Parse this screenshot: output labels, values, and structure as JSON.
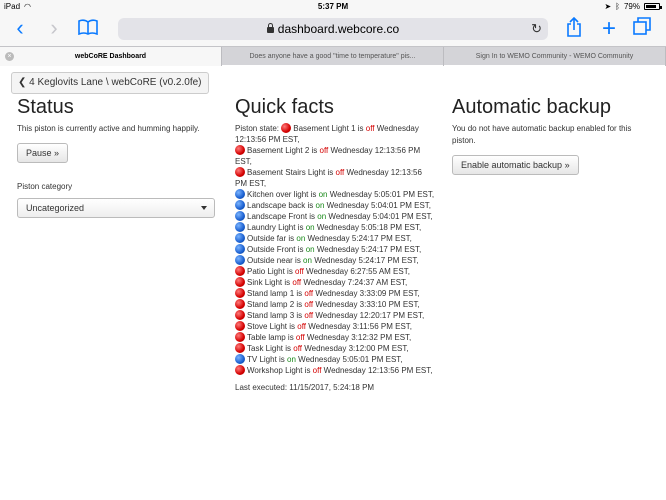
{
  "status_bar": {
    "device": "iPad",
    "time": "5:37 PM",
    "battery": "79%"
  },
  "browser": {
    "url": "dashboard.webcore.co",
    "tabs": [
      {
        "label": "webCoRE Dashboard",
        "active": true
      },
      {
        "label": "Does anyone have a good \"time to temperature\" pis...",
        "active": false
      },
      {
        "label": "Sign In to WEMO Community - WEMO Community",
        "active": false
      }
    ]
  },
  "breadcrumb": "4 Keglovits Lane \\ webCoRE (v0.2.0fe)",
  "status": {
    "title": "Status",
    "text": "This piston is currently active and humming happily.",
    "pause_button": "Pause »",
    "category_label": "Piston category",
    "category_value": "Uncategorized"
  },
  "quick_facts": {
    "title": "Quick facts",
    "state_label": "Piston state:",
    "items": [
      {
        "color": "red",
        "name": "Basement Light 1",
        "state": "off",
        "when": "Wednesday 12:13:56 PM EST,"
      },
      {
        "color": "red",
        "name": "Basement Light 2",
        "state": "off",
        "when": "Wednesday 12:13:56 PM EST,"
      },
      {
        "color": "red",
        "name": "Basement Stairs Light",
        "state": "off",
        "when": "Wednesday 12:13:56 PM EST,"
      },
      {
        "color": "blue",
        "name": "Kitchen over light",
        "state": "on",
        "when": "Wednesday 5:05:01 PM EST,"
      },
      {
        "color": "blue",
        "name": "Landscape back",
        "state": "on",
        "when": "Wednesday 5:04:01 PM EST,"
      },
      {
        "color": "blue",
        "name": "Landscape Front",
        "state": "on",
        "when": "Wednesday 5:04:01 PM EST,"
      },
      {
        "color": "blue",
        "name": "Laundry Light",
        "state": "on",
        "when": "Wednesday 5:05:18 PM EST,"
      },
      {
        "color": "blue",
        "name": "Outside far",
        "state": "on",
        "when": "Wednesday 5:24:17 PM EST,"
      },
      {
        "color": "blue",
        "name": "Outside Front",
        "state": "on",
        "when": "Wednesday 5:24:17 PM EST,"
      },
      {
        "color": "blue",
        "name": "Outside near",
        "state": "on",
        "when": "Wednesday 5:24:17 PM EST,"
      },
      {
        "color": "red",
        "name": "Patio Light",
        "state": "off",
        "when": "Wednesday 6:27:55 AM EST,"
      },
      {
        "color": "red",
        "name": "Sink Light",
        "state": "off",
        "when": "Wednesday 7:24:37 AM EST,"
      },
      {
        "color": "red",
        "name": "Stand lamp 1",
        "state": "off",
        "when": "Wednesday 3:33:09 PM EST,"
      },
      {
        "color": "red",
        "name": "Stand lamp 2",
        "state": "off",
        "when": "Wednesday 3:33:10 PM EST,"
      },
      {
        "color": "red",
        "name": "Stand lamp 3",
        "state": "off",
        "when": "Wednesday 12:20:17 PM EST,"
      },
      {
        "color": "red",
        "name": "Stove Light",
        "state": "off",
        "when": "Wednesday 3:11:56 PM EST,"
      },
      {
        "color": "red",
        "name": "Table lamp",
        "state": "off",
        "when": "Wednesday 3:12:32 PM EST,"
      },
      {
        "color": "red",
        "name": "Task Light",
        "state": "off",
        "when": "Wednesday 3:12:00 PM EST,"
      },
      {
        "color": "blue",
        "name": "TV Light",
        "state": "on",
        "when": "Wednesday 5:05:01 PM EST,"
      },
      {
        "color": "red",
        "name": "Workshop Light",
        "state": "off",
        "when": "Wednesday 12:13:56 PM EST,"
      }
    ],
    "last_executed": "Last executed: 11/15/2017, 5:24:18 PM"
  },
  "backup": {
    "title": "Automatic backup",
    "text": "You do not have automatic backup enabled for this piston.",
    "button": "Enable automatic backup »"
  },
  "colors": {
    "accent": "#0a7aff",
    "off": "#d40000",
    "on": "#1a8a1a"
  }
}
